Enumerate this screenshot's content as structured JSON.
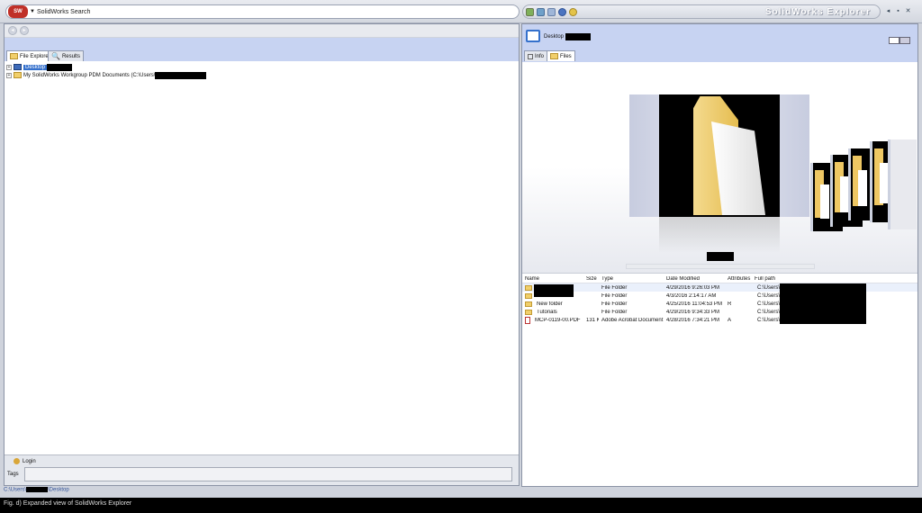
{
  "search": {
    "logo": "SW",
    "label": "SolidWorks Search"
  },
  "explorer": {
    "title": "SolidWorks Explorer"
  },
  "left": {
    "tabs": [
      {
        "label": "File Explorer"
      },
      {
        "label": "Results"
      }
    ],
    "tree": [
      {
        "label": "Desktop"
      },
      {
        "label": "My SolidWorks Workgroup PDM Documents (C:\\Users\\"
      }
    ],
    "login_label": "Login",
    "tags_label": "Tags",
    "status_path_prefix": "C:\\Users\\",
    "status_path_suffix": "\\Desktop"
  },
  "right": {
    "title": "Desktop",
    "tabs": [
      {
        "label": "Info"
      },
      {
        "label": "Files"
      }
    ],
    "columns": [
      "Name",
      "Size",
      "Type",
      "Date Modified",
      "Attributes",
      "Full path"
    ],
    "rows": [
      {
        "name": "",
        "size": "",
        "type": "File Folder",
        "date": "4/29/2016 9:26:03 PM",
        "attr": "",
        "path": "C:\\Users\\"
      },
      {
        "name": "",
        "size": "",
        "type": "File Folder",
        "date": "4/3/2016 2:14:17 AM",
        "attr": "",
        "path": "C:\\Users\\"
      },
      {
        "name": "New folder",
        "size": "",
        "type": "File Folder",
        "date": "4/25/2016 11:04:53 PM",
        "attr": "R",
        "path": "C:\\Users\\"
      },
      {
        "name": "Tutorials",
        "size": "",
        "type": "File Folder",
        "date": "4/29/2016 9:34:33 PM",
        "attr": "",
        "path": "C:\\Users\\"
      },
      {
        "name": "MCP-0119-00.PDF",
        "size": "131 KB",
        "type": "Adobe Acrobat Document",
        "date": "4/28/2016 7:34:21 PM",
        "attr": "A",
        "path": "C:\\Users\\"
      }
    ]
  },
  "caption": "Fig. d) Expanded view of SolidWorks Explorer"
}
